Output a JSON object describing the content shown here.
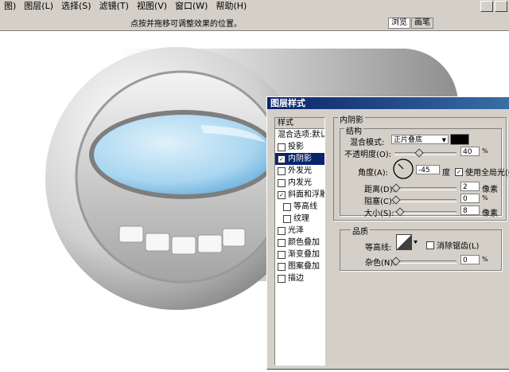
{
  "menu": [
    "图)",
    "图层(L)",
    "选择(S)",
    "滤镜(T)",
    "视图(V)",
    "窗口(W)",
    "帮助(H)"
  ],
  "hint": "点按并拖移可调整效果的位置。",
  "palette_tabs": [
    "浏览",
    "画笔"
  ],
  "dialog": {
    "title": "图层样式",
    "styles_header": "样式",
    "style_items": [
      {
        "label": "混合选项:默认",
        "checked": null,
        "sub": false,
        "selected": false
      },
      {
        "label": "投影",
        "checked": false,
        "sub": false,
        "selected": false
      },
      {
        "label": "内阴影",
        "checked": true,
        "sub": false,
        "selected": true
      },
      {
        "label": "外发光",
        "checked": false,
        "sub": false,
        "selected": false
      },
      {
        "label": "内发光",
        "checked": false,
        "sub": false,
        "selected": false
      },
      {
        "label": "斜面和浮雕",
        "checked": true,
        "sub": false,
        "selected": false
      },
      {
        "label": "等高线",
        "checked": false,
        "sub": true,
        "selected": false
      },
      {
        "label": "纹理",
        "checked": false,
        "sub": true,
        "selected": false
      },
      {
        "label": "光泽",
        "checked": false,
        "sub": false,
        "selected": false
      },
      {
        "label": "颜色叠加",
        "checked": false,
        "sub": false,
        "selected": false
      },
      {
        "label": "渐变叠加",
        "checked": false,
        "sub": false,
        "selected": false
      },
      {
        "label": "图案叠加",
        "checked": false,
        "sub": false,
        "selected": false
      },
      {
        "label": "描边",
        "checked": false,
        "sub": false,
        "selected": false
      }
    ],
    "section_title": "内阴影",
    "structure": {
      "title": "结构",
      "blend_mode_label": "混合模式:",
      "blend_mode_value": "正片叠底",
      "shadow_color": "#000000",
      "opacity_label": "不透明度(O):",
      "opacity_value": "40",
      "opacity_unit": "%",
      "opacity_level": 0.4,
      "angle_label": "角度(A):",
      "angle_value": "-45",
      "angle_unit": "度",
      "global_light_label": "使用全局光(G)",
      "global_light_checked": true,
      "distance_label": "距离(D):",
      "distance_value": "2",
      "distance_unit": "像素",
      "choke_label": "阻塞(C):",
      "choke_value": "0",
      "choke_unit": "%",
      "size_label": "大小(S):",
      "size_value": "8",
      "size_unit": "像素"
    },
    "quality": {
      "title": "品质",
      "contour_label": "等高线:",
      "antialias_label": "消除锯齿(L)",
      "antialias_checked": false,
      "noise_label": "杂色(N):",
      "noise_value": "0",
      "noise_unit": "%"
    }
  },
  "colors": {
    "chrome": "#d4d0c8",
    "selection": "#0a246a",
    "lens": "#a9d6f0"
  }
}
